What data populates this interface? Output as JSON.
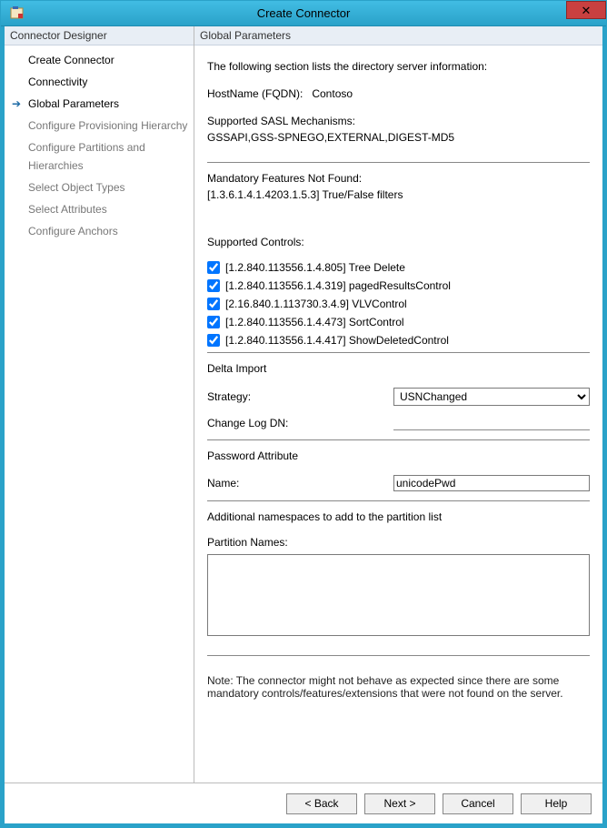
{
  "window": {
    "title": "Create Connector"
  },
  "sidebar": {
    "header": "Connector Designer",
    "items": [
      {
        "label": "Create Connector",
        "disabled": false,
        "current": false
      },
      {
        "label": "Connectivity",
        "disabled": false,
        "current": false
      },
      {
        "label": "Global Parameters",
        "disabled": false,
        "current": true
      },
      {
        "label": "Configure Provisioning Hierarchy",
        "disabled": true,
        "current": false
      },
      {
        "label": "Configure Partitions and Hierarchies",
        "disabled": true,
        "current": false
      },
      {
        "label": "Select Object Types",
        "disabled": true,
        "current": false
      },
      {
        "label": "Select Attributes",
        "disabled": true,
        "current": false
      },
      {
        "label": "Configure Anchors",
        "disabled": true,
        "current": false
      }
    ]
  },
  "main": {
    "header": "Global Parameters",
    "intro": "The following section lists the directory server information:",
    "hostname_label": "HostName (FQDN):",
    "hostname_value": "Contoso",
    "sasl_label": "Supported SASL Mechanisms:",
    "sasl_value": "GSSAPI,GSS-SPNEGO,EXTERNAL,DIGEST-MD5",
    "mandatory_label": "Mandatory Features Not Found:",
    "mandatory_value": "[1.3.6.1.4.1.4203.1.5.3] True/False filters",
    "controls_title": "Supported Controls:",
    "controls": [
      {
        "oid": "[1.2.840.113556.1.4.805]",
        "name": "Tree Delete",
        "checked": true
      },
      {
        "oid": "[1.2.840.113556.1.4.319]",
        "name": "pagedResultsControl",
        "checked": true
      },
      {
        "oid": "[2.16.840.1.113730.3.4.9]",
        "name": "VLVControl",
        "checked": true
      },
      {
        "oid": "[1.2.840.113556.1.4.473]",
        "name": "SortControl",
        "checked": true
      },
      {
        "oid": "[1.2.840.113556.1.4.417]",
        "name": "ShowDeletedControl",
        "checked": true
      }
    ],
    "delta_heading": "Delta Import",
    "strategy_label": "Strategy:",
    "strategy_options": [
      "USNChanged"
    ],
    "strategy_selected": "USNChanged",
    "changelog_label": "Change Log DN:",
    "changelog_value": "",
    "pwd_heading": "Password Attribute",
    "pwd_name_label": "Name:",
    "pwd_name_value": "unicodePwd",
    "ns_heading": "Additional namespaces to add to the partition list",
    "partition_label": "Partition Names:",
    "partition_value": "",
    "note": "Note: The connector might not behave as expected since there are some mandatory controls/features/extensions that were not found on the server."
  },
  "footer": {
    "back": "<  Back",
    "next": "Next  >",
    "cancel": "Cancel",
    "help": "Help"
  }
}
